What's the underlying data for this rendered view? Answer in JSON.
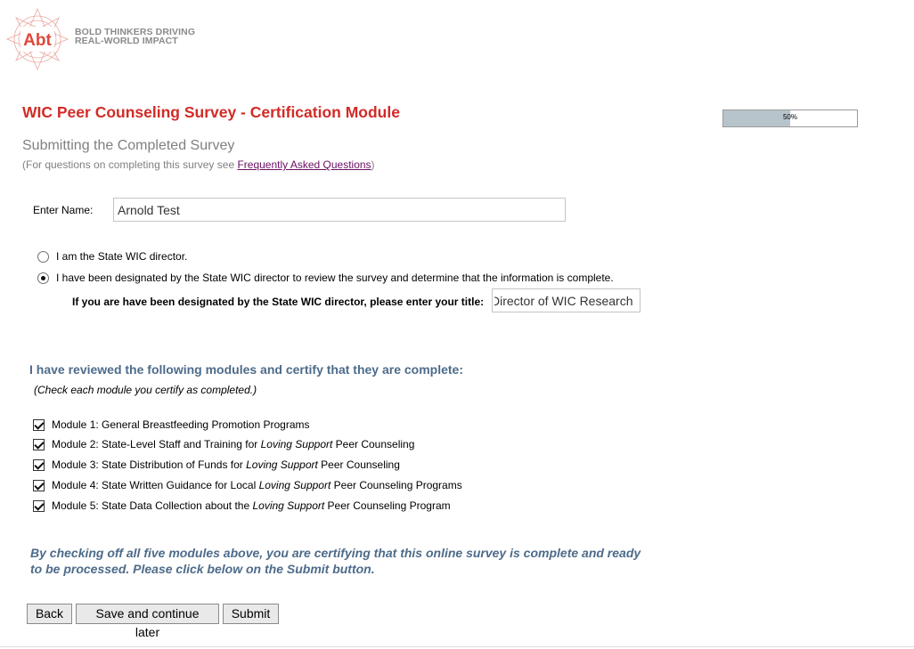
{
  "brand": {
    "logo_text": "Abt",
    "tagline_line1": "BOLD THINKERS DRIVING",
    "tagline_line2": "REAL-WORLD IMPACT",
    "accent_color": "#d22b26"
  },
  "header": {
    "title": "WIC Peer Counseling Survey - Certification Module",
    "progress_label": "50%",
    "progress_fraction": 0.5
  },
  "intro": {
    "subtitle": "Submitting the Completed Survey",
    "faq_prefix": "(For questions on completing this survey see ",
    "faq_link": "Frequently Asked Questions",
    "faq_suffix": ")"
  },
  "name": {
    "label": "Enter Name:",
    "value": "Arnold Test"
  },
  "role": {
    "option1": "I am the State WIC director.",
    "option2": "I have been designated by the State WIC director to review the survey and determine that the information is complete.",
    "selected": "option2",
    "title_label": "If you are have been designated by the State WIC director, please enter your title:",
    "title_value": "Director of WIC Research"
  },
  "certification": {
    "heading": "I have reviewed the following modules and certify that they are complete:",
    "note": "(Check each module you certify as completed.)",
    "modules": [
      {
        "pre": "Module 1: General Breastfeeding Promotion Programs",
        "italic": "",
        "post": "",
        "checked": true
      },
      {
        "pre": "Module 2: State-Level Staff and Training for ",
        "italic": "Loving Support",
        "post": " Peer Counseling",
        "checked": true
      },
      {
        "pre": "Module 3: State Distribution of Funds for ",
        "italic": "Loving Support",
        "post": " Peer Counseling",
        "checked": true
      },
      {
        "pre": "Module 4: State Written Guidance for Local ",
        "italic": "Loving Support",
        "post": " Peer Counseling Programs",
        "checked": true
      },
      {
        "pre": "Module 5: State Data Collection about the ",
        "italic": "Loving Support",
        "post": " Peer Counseling Program",
        "checked": true
      }
    ],
    "statement": "By checking off all five modules above, you are certifying that this online survey is complete and ready to be processed. Please click below on the Submit button."
  },
  "buttons": {
    "back": "Back",
    "save": "Save and continue later",
    "submit": "Submit"
  }
}
